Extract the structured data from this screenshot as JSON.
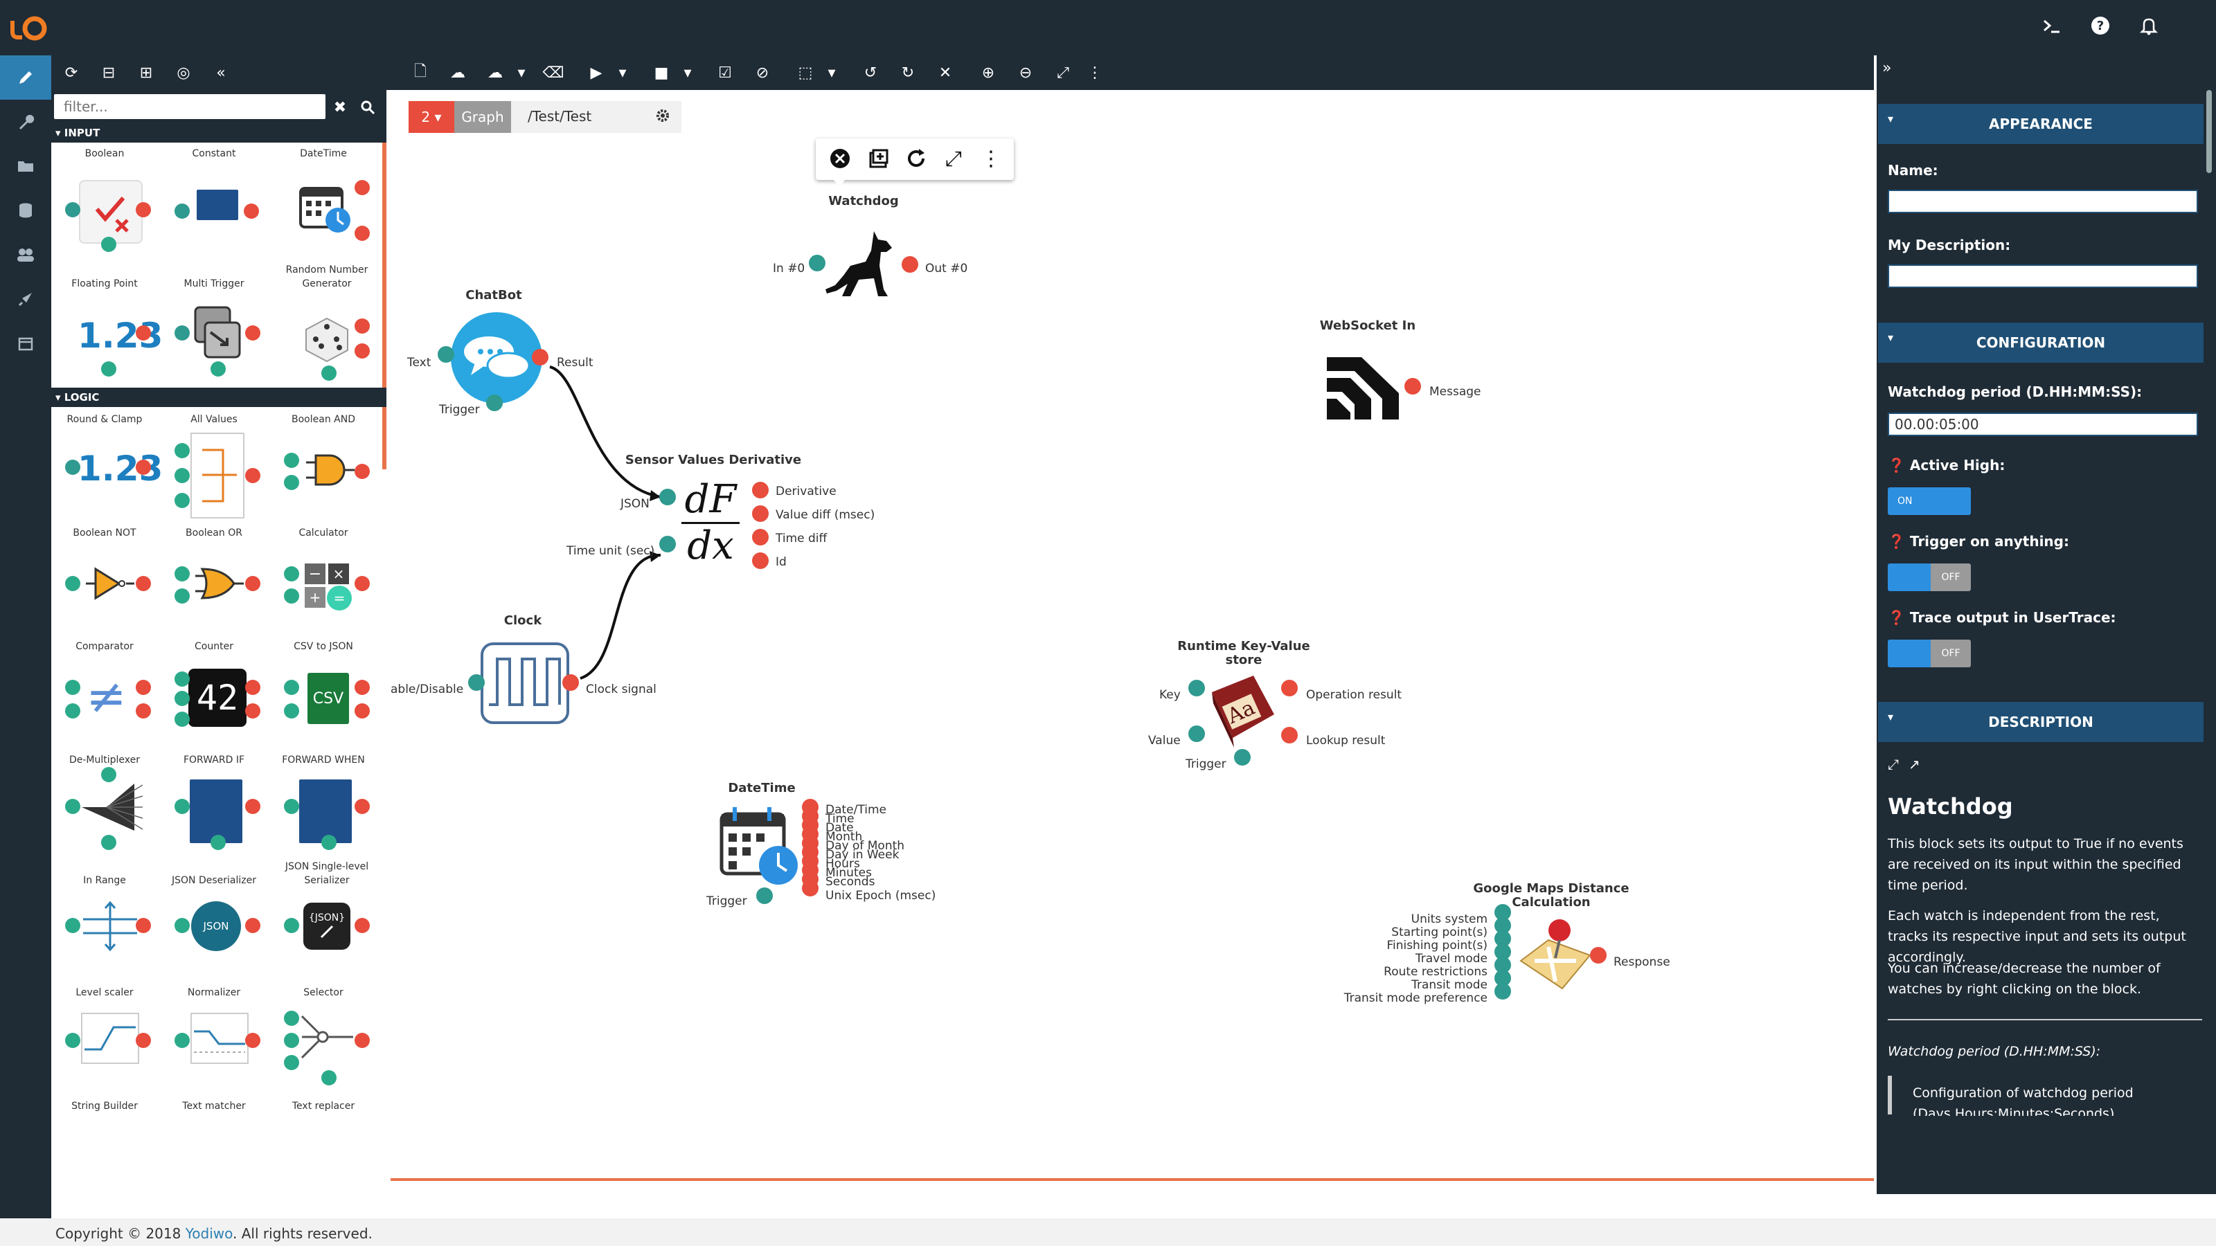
{
  "topbar": {
    "logo_icon": "yodiwo-logo-icon",
    "icons": [
      "terminal-icon",
      "help-icon",
      "bell-icon"
    ]
  },
  "leftnav": {
    "items": [
      "pen-icon",
      "wrench-icon",
      "folder-icon",
      "database-icon",
      "users-icon",
      "rocket-icon",
      "calendar-icon"
    ]
  },
  "palette": {
    "filter_placeholder": "filter...",
    "sections": [
      {
        "title": "INPUT"
      },
      {
        "title": "LOGIC"
      }
    ],
    "input_items": [
      "Boolean",
      "Constant",
      "DateTime",
      "Floating Point",
      "Multi Trigger",
      "Random Number Generator"
    ],
    "logic_items": [
      "Round & Clamp",
      "All Values",
      "Boolean AND",
      "Boolean NOT",
      "Boolean OR",
      "Calculator",
      "Comparator",
      "Counter",
      "CSV to JSON",
      "De-Multiplexer",
      "FORWARD IF",
      "FORWARD WHEN",
      "In Range",
      "JSON Deserializer",
      "JSON Single-level Serializer",
      "Level scaler",
      "Normalizer",
      "Selector",
      "String Builder",
      "Text matcher",
      "Text replacer"
    ],
    "icon_texts": {
      "floating_point": "1.23",
      "round_clamp": "1.23",
      "counter": "42",
      "csv": "CSV",
      "normalizer": "JSON"
    }
  },
  "tabbar": {
    "number": "2",
    "graph_label": "Graph",
    "path": "/Test/Test"
  },
  "nodes": {
    "watchdog": {
      "title": "Watchdog",
      "in": "In #0",
      "out": "Out #0"
    },
    "chatbot": {
      "title": "ChatBot",
      "in1": "Text",
      "in2": "Trigger",
      "out": "Result"
    },
    "websocket": {
      "title": "WebSocket In",
      "out": "Message"
    },
    "derivative": {
      "title": "Sensor Values Derivative",
      "in1": "JSON",
      "in2": "Time unit (sec)",
      "outs": [
        "Derivative",
        "Value diff (msec)",
        "Time diff",
        "Id"
      ],
      "formula_top": "dF",
      "formula_bottom": "dx"
    },
    "clock": {
      "title": "Clock",
      "in": "able/Disable",
      "out": "Clock signal"
    },
    "kvstore": {
      "title": "Runtime Key-Value store",
      "in1": "Key",
      "in2": "Value",
      "in3": "Trigger",
      "out1": "Operation result",
      "out2": "Lookup result"
    },
    "datetime": {
      "title": "DateTime",
      "in": "Trigger",
      "outs": [
        "Date/Time",
        "Time",
        "Date",
        "Month",
        "Day of Month",
        "Day in Week",
        "Hours",
        "Minutes",
        "Seconds",
        "Unix Epoch (msec)"
      ]
    },
    "gmaps": {
      "title": "Google Maps Distance Calculation",
      "ins": [
        "Units system",
        "Starting point(s)",
        "Finishing point(s)",
        "Travel mode",
        "Route restrictions",
        "Transit mode",
        "Transit mode preference"
      ],
      "out": "Response"
    }
  },
  "rightpanel": {
    "appearance": "APPEARANCE",
    "name_label": "Name:",
    "name_value": "",
    "desc_label": "My Description:",
    "desc_value": "",
    "configuration": "CONFIGURATION",
    "period_label": "Watchdog period (D.HH:MM:SS):",
    "period_value": "00.00:05:00",
    "active_high_label": "Active High:",
    "active_high_state": "ON",
    "trigger_anything_label": "Trigger on anything:",
    "trigger_anything_state": "OFF",
    "trace_output_label": "Trace output in UserTrace:",
    "trace_output_state": "OFF",
    "description": "DESCRIPTION",
    "desc_title": "Watchdog",
    "desc_p1": "This block sets its output to True if no events are received on its input within the specified time period.",
    "desc_p2": "Each watch is independent from the rest, tracks its respective input and sets its output accordingly.",
    "desc_p3": "You can increase/decrease the number of watches by right clicking on the block.",
    "desc_param": "Watchdog period (D.HH:MM:SS):",
    "desc_param_text": "Configuration of watchdog period (Days.Hours:Minutes:Seconds)"
  },
  "footer": {
    "prefix": "Copyright © 2018 ",
    "link": "Yodiwo",
    "suffix": ". All rights reserved."
  },
  "colors": {
    "dark_bg": "#1f2b35",
    "accent_blue": "#2d7fb2",
    "section_blue": "#1f4f74",
    "port_red": "#e74c3c",
    "port_teal": "#2f9a8f",
    "orange": "#e8734a"
  }
}
